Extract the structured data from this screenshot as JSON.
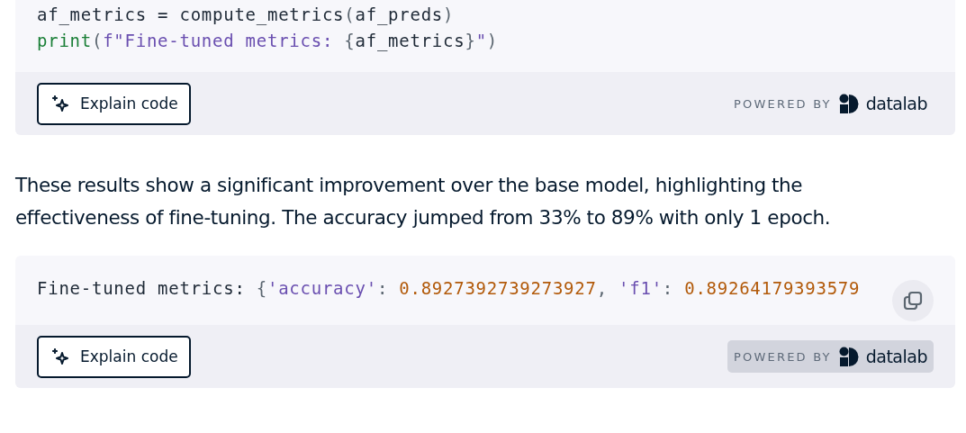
{
  "cells": [
    {
      "kind": "code",
      "lines": [
        [
          {
            "text": "af_metrics = compute_metrics",
            "kind": "plain"
          },
          {
            "text": "(",
            "kind": "punct"
          },
          {
            "text": "af_preds",
            "kind": "plain"
          },
          {
            "text": ")",
            "kind": "punct"
          }
        ],
        [
          {
            "text": "print",
            "kind": "builtin"
          },
          {
            "text": "(",
            "kind": "punct"
          },
          {
            "text": "f\"Fine-tuned metrics: ",
            "kind": "string"
          },
          {
            "text": "{",
            "kind": "punct"
          },
          {
            "text": "af_metrics",
            "kind": "plain"
          },
          {
            "text": "}",
            "kind": "punct"
          },
          {
            "text": "\"",
            "kind": "string"
          },
          {
            "text": ")",
            "kind": "punct"
          }
        ]
      ],
      "button": "Explain code",
      "powered_by": "POWERED BY",
      "brand": "datalab",
      "highlighted": false
    },
    {
      "kind": "text",
      "text": "These results show a significant improvement over the base model, highlighting the effectiveness of fine-tuning. The accuracy jumped from 33% to 89% with only 1 epoch."
    },
    {
      "kind": "output",
      "lines": [
        [
          {
            "text": "Fine-tuned metrics: ",
            "kind": "plain"
          },
          {
            "text": "{",
            "kind": "punct"
          },
          {
            "text": "'accuracy'",
            "kind": "string"
          },
          {
            "text": ": ",
            "kind": "punct"
          },
          {
            "text": "0.8927392739273927",
            "kind": "number"
          },
          {
            "text": ", ",
            "kind": "punct"
          },
          {
            "text": "'f1'",
            "kind": "string"
          },
          {
            "text": ": ",
            "kind": "punct"
          },
          {
            "text": "0.89264179393579",
            "kind": "number"
          }
        ]
      ],
      "copy_button": true,
      "button": "Explain code",
      "powered_by": "POWERED BY",
      "brand": "datalab",
      "highlighted": true
    }
  ]
}
